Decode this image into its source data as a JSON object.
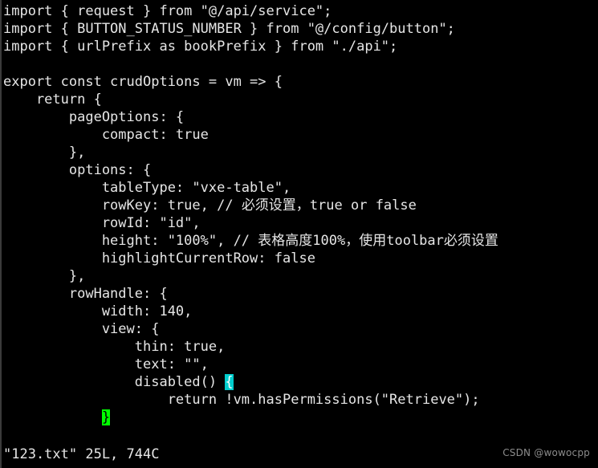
{
  "terminal": {
    "background_color": "#000000",
    "foreground_color": "#e6e6e6",
    "cursor_color": "#00cdcd",
    "matchparen_color": "#00ff00",
    "watermark_color": "#8c8c8c"
  },
  "editor": {
    "lines": [
      "import { request } from \"@/api/service\";",
      "import { BUTTON_STATUS_NUMBER } from \"@/config/button\";",
      "import { urlPrefix as bookPrefix } from \"./api\";",
      "",
      "export const crudOptions = vm => {",
      "    return {",
      "        pageOptions: {",
      "            compact: true",
      "        },",
      "        options: {",
      "            tableType: \"vxe-table\",",
      "            rowKey: true, // 必须设置，true or false",
      "            rowId: \"id\",",
      "            height: \"100%\", // 表格高度100%，使用toolbar必须设置",
      "            highlightCurrentRow: false",
      "        },",
      "        rowHandle: {",
      "            width: 140,",
      "            view: {",
      "                thin: true,",
      "                text: \"\",",
      "                disabled() {",
      "                    return !vm.hasPermissions(\"Retrieve\");",
      "                }"
    ],
    "line_segments": [
      [
        {
          "t": "import { request } from \"@/api/service\";"
        }
      ],
      [
        {
          "t": "import { BUTTON_STATUS_NUMBER } from \"@/config/button\";"
        }
      ],
      [
        {
          "t": "import { urlPrefix as bookPrefix } from \"./api\";"
        }
      ],
      [
        {
          "t": ""
        }
      ],
      [
        {
          "t": "export const crudOptions = vm => {"
        }
      ],
      [
        {
          "t": "    return {"
        }
      ],
      [
        {
          "t": "        pageOptions: {"
        }
      ],
      [
        {
          "t": "            compact: true"
        }
      ],
      [
        {
          "t": "        },"
        }
      ],
      [
        {
          "t": "        options: {"
        }
      ],
      [
        {
          "t": "            tableType: \"vxe-table\","
        }
      ],
      [
        {
          "t": "            rowKey: true, // "
        },
        {
          "t": "必须设置，",
          "cjk": true
        },
        {
          "t": "true or false"
        }
      ],
      [
        {
          "t": "            rowId: \"id\","
        }
      ],
      [
        {
          "t": "            height: \"100%\", // "
        },
        {
          "t": "表格高度",
          "cjk": true
        },
        {
          "t": "100%"
        },
        {
          "t": "，使用",
          "cjk": true
        },
        {
          "t": "toolbar"
        },
        {
          "t": "必须设置",
          "cjk": true
        }
      ],
      [
        {
          "t": "            highlightCurrentRow: false"
        }
      ],
      [
        {
          "t": "        },"
        }
      ],
      [
        {
          "t": "        rowHandle: {"
        }
      ],
      [
        {
          "t": "            width: 140,"
        }
      ],
      [
        {
          "t": "            view: {"
        }
      ],
      [
        {
          "t": "                thin: true,"
        }
      ],
      [
        {
          "t": "                text: \"\","
        }
      ],
      [
        {
          "t": "                disabled() "
        },
        {
          "t": "{",
          "style": "cursor"
        }
      ],
      [
        {
          "t": "                    return !vm.hasPermissions(\"Retrieve\");"
        }
      ],
      [
        {
          "t": "            "
        },
        {
          "t": "}",
          "style": "matchparen"
        }
      ]
    ]
  },
  "statusline": {
    "text": "\"123.txt\" 25L, 744C",
    "filename": "123.txt",
    "line_count": "25L",
    "char_count": "744C"
  },
  "watermark": {
    "text": "CSDN @wowocpp"
  }
}
